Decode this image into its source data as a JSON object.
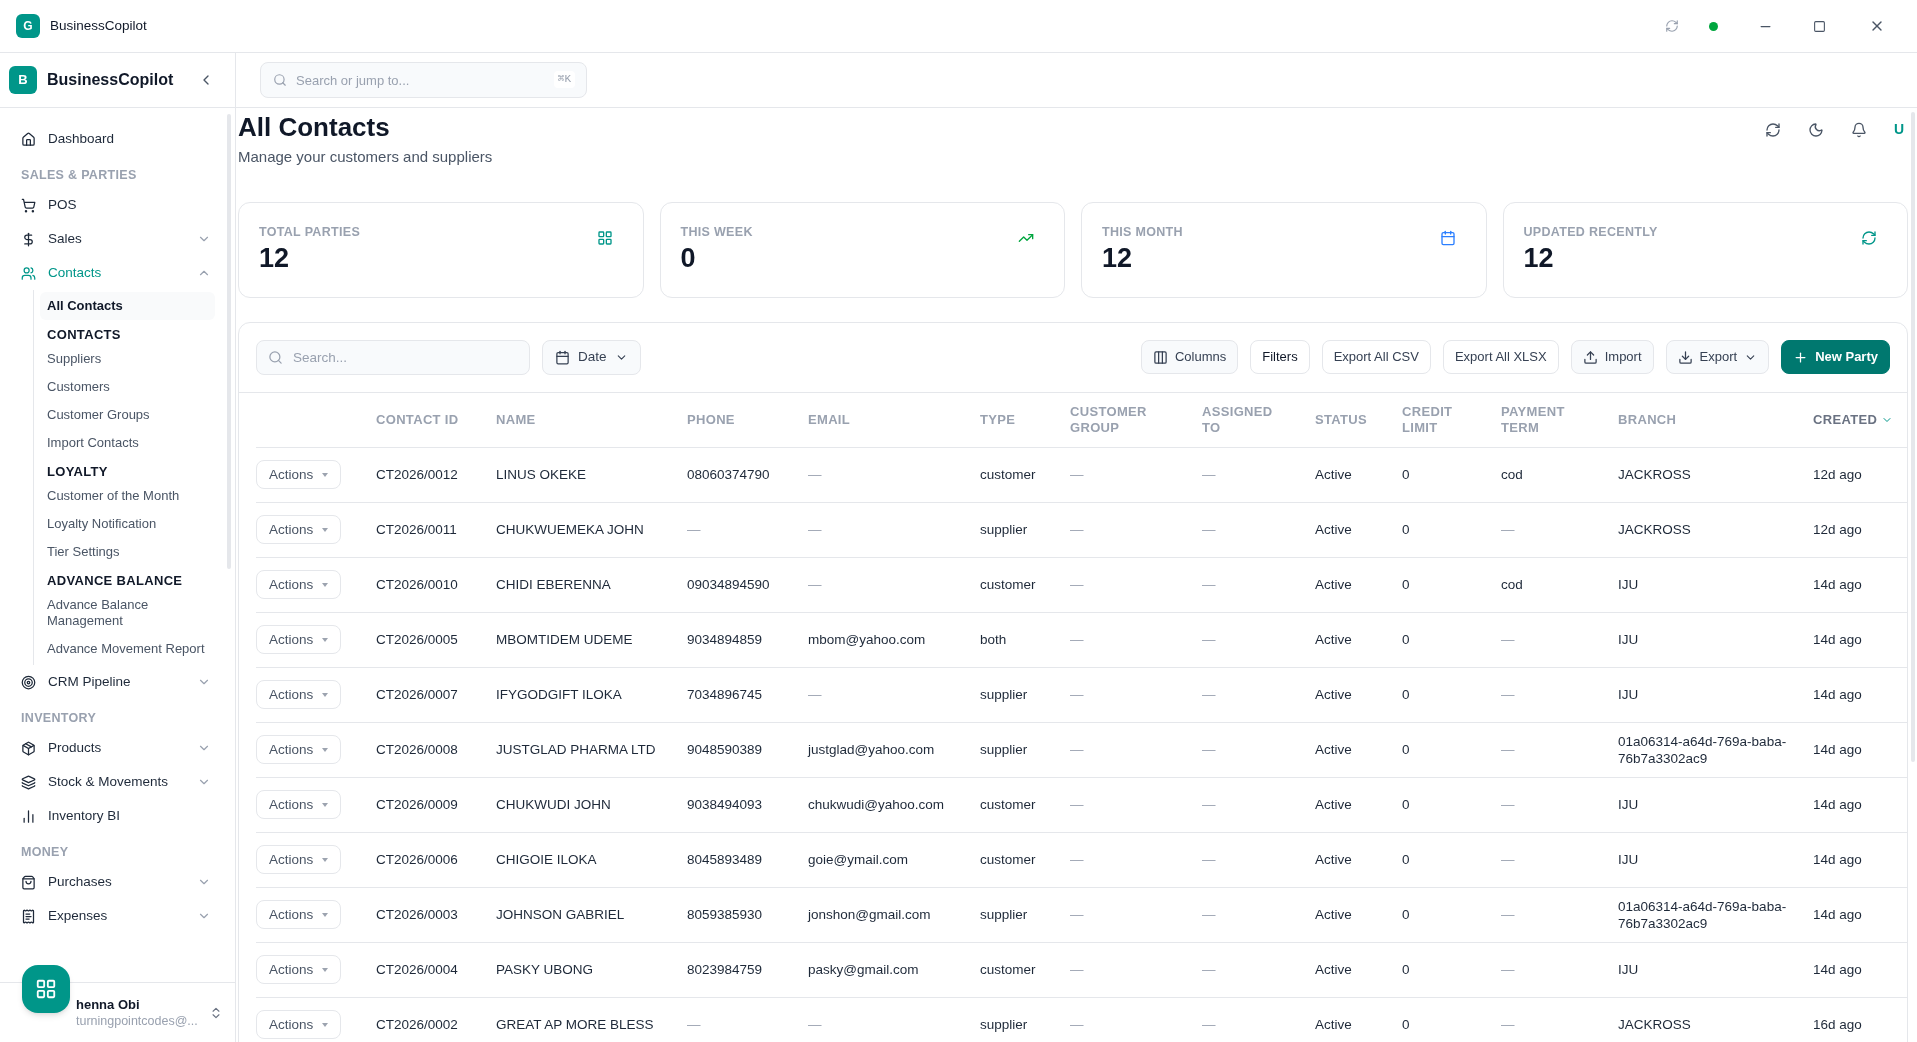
{
  "window": {
    "app_letter": "G",
    "title": "BusinessCopilot"
  },
  "sidebar": {
    "brand_letter": "B",
    "brand": "BusinessCopilot",
    "items": [
      {
        "kind": "item",
        "label": "Dashboard",
        "selected": false
      },
      {
        "kind": "section",
        "label": "SALES & PARTIES"
      },
      {
        "kind": "item",
        "label": "POS",
        "selected": false
      },
      {
        "kind": "item",
        "label": "Sales",
        "selected": false,
        "expanded": false
      },
      {
        "kind": "item",
        "label": "Contacts",
        "selected": true,
        "expanded": true,
        "children": [
          {
            "kind": "link",
            "label": "All Contacts",
            "selected": true
          },
          {
            "kind": "heading",
            "label": "CONTACTS"
          },
          {
            "kind": "link",
            "label": "Suppliers",
            "selected": false
          },
          {
            "kind": "link",
            "label": "Customers",
            "selected": false
          },
          {
            "kind": "link",
            "label": "Customer Groups",
            "selected": false
          },
          {
            "kind": "link",
            "label": "Import Contacts",
            "selected": false
          },
          {
            "kind": "heading",
            "label": "LOYALTY"
          },
          {
            "kind": "link",
            "label": "Customer of the Month",
            "selected": false
          },
          {
            "kind": "link",
            "label": "Loyalty Notification",
            "selected": false
          },
          {
            "kind": "link",
            "label": "Tier Settings",
            "selected": false
          },
          {
            "kind": "heading",
            "label": "ADVANCE BALANCE"
          },
          {
            "kind": "link",
            "label": "Advance Balance Management",
            "selected": false
          },
          {
            "kind": "link",
            "label": "Advance Movement Report",
            "selected": false
          }
        ]
      },
      {
        "kind": "item",
        "label": "CRM Pipeline",
        "selected": false,
        "expanded": false
      },
      {
        "kind": "section",
        "label": "INVENTORY"
      },
      {
        "kind": "item",
        "label": "Products",
        "selected": false,
        "expanded": false
      },
      {
        "kind": "item",
        "label": "Stock & Movements",
        "selected": false,
        "expanded": false
      },
      {
        "kind": "item",
        "label": "Inventory BI",
        "selected": false
      },
      {
        "kind": "section",
        "label": "MONEY"
      },
      {
        "kind": "item",
        "label": "Purchases",
        "selected": false,
        "expanded": false
      },
      {
        "kind": "item",
        "label": "Expenses",
        "selected": false,
        "expanded": false
      }
    ],
    "user": {
      "name": "henna Obi",
      "email": "turningpointcodes@..."
    }
  },
  "search": {
    "placeholder": "Search or jump to...",
    "shortcut": "⌘K"
  },
  "header": {
    "title": "All Contacts",
    "subtitle": "Manage your customers and suppliers",
    "avatar": "U"
  },
  "stats": [
    {
      "label": "TOTAL PARTIES",
      "value": "12"
    },
    {
      "label": "THIS WEEK",
      "value": "0"
    },
    {
      "label": "THIS MONTH",
      "value": "12"
    },
    {
      "label": "UPDATED RECENTLY",
      "value": "12"
    }
  ],
  "toolbar": {
    "search_placeholder": "Search...",
    "date": "Date",
    "buttons": [
      {
        "kind": "muted",
        "label": "Columns"
      },
      {
        "kind": "strong",
        "label": "Filters"
      },
      {
        "kind": "outline",
        "label": "Export All CSV"
      },
      {
        "kind": "outline",
        "label": "Export All XLSX"
      },
      {
        "kind": "muted",
        "label": "Import"
      },
      {
        "kind": "menu",
        "label": "Export"
      },
      {
        "kind": "primary",
        "label": "New Party"
      }
    ]
  },
  "table": {
    "columns": [
      {
        "label": "CONTACT ID",
        "sorted": false
      },
      {
        "label": "NAME",
        "sorted": false
      },
      {
        "label": "PHONE",
        "sorted": false
      },
      {
        "label": "EMAIL",
        "sorted": false
      },
      {
        "label": "TYPE",
        "sorted": false
      },
      {
        "label": "CUSTOMER GROUP",
        "sorted": false
      },
      {
        "label": "ASSIGNED TO",
        "sorted": false
      },
      {
        "label": "STATUS",
        "sorted": false
      },
      {
        "label": "CREDIT LIMIT",
        "sorted": false
      },
      {
        "label": "PAYMENT TERM",
        "sorted": false
      },
      {
        "label": "BRANCH",
        "sorted": false
      },
      {
        "label": "CREATED",
        "sorted": true
      }
    ],
    "rows": [
      {
        "action": "Actions",
        "cells": [
          "CT2026/0012",
          "LINUS OKEKE",
          "08060374790",
          "—",
          "customer",
          "—",
          "—",
          "Active",
          "0",
          "cod",
          "JACKROSS",
          "12d ago"
        ]
      },
      {
        "action": "Actions",
        "cells": [
          "CT2026/0011",
          "CHUKWUEMEKA JOHN",
          "—",
          "—",
          "supplier",
          "—",
          "—",
          "Active",
          "0",
          "—",
          "JACKROSS",
          "12d ago"
        ]
      },
      {
        "action": "Actions",
        "cells": [
          "CT2026/0010",
          "CHIDI EBERENNA",
          "09034894590",
          "—",
          "customer",
          "—",
          "—",
          "Active",
          "0",
          "cod",
          "IJU",
          "14d ago"
        ]
      },
      {
        "action": "Actions",
        "cells": [
          "CT2026/0005",
          "MBOMTIDEM UDEME",
          "9034894859",
          "mbom@yahoo.com",
          "both",
          "—",
          "—",
          "Active",
          "0",
          "—",
          "IJU",
          "14d ago"
        ]
      },
      {
        "action": "Actions",
        "cells": [
          "CT2026/0007",
          "IFYGODGIFT ILOKA",
          "7034896745",
          "—",
          "supplier",
          "—",
          "—",
          "Active",
          "0",
          "—",
          "IJU",
          "14d ago"
        ]
      },
      {
        "action": "Actions",
        "cells": [
          "CT2026/0008",
          "JUSTGLAD PHARMA LTD",
          "9048590389",
          "justglad@yahoo.com",
          "supplier",
          "—",
          "—",
          "Active",
          "0",
          "—",
          "01a06314-a64d-769a-baba-76b7a3302ac9",
          "14d ago"
        ]
      },
      {
        "action": "Actions",
        "cells": [
          "CT2026/0009",
          "CHUKWUDI JOHN",
          "9038494093",
          "chukwudi@yahoo.com",
          "customer",
          "—",
          "—",
          "Active",
          "0",
          "—",
          "IJU",
          "14d ago"
        ]
      },
      {
        "action": "Actions",
        "cells": [
          "CT2026/0006",
          "CHIGOIE ILOKA",
          "8045893489",
          "goie@ymail.com",
          "customer",
          "—",
          "—",
          "Active",
          "0",
          "—",
          "IJU",
          "14d ago"
        ]
      },
      {
        "action": "Actions",
        "cells": [
          "CT2026/0003",
          "JOHNSON GABRIEL",
          "8059385930",
          "jonshon@gmail.com",
          "supplier",
          "—",
          "—",
          "Active",
          "0",
          "—",
          "01a06314-a64d-769a-baba-76b7a3302ac9",
          "14d ago"
        ]
      },
      {
        "action": "Actions",
        "cells": [
          "CT2026/0004",
          "PASKY UBONG",
          "8023984759",
          "pasky@gmail.com",
          "customer",
          "—",
          "—",
          "Active",
          "0",
          "—",
          "IJU",
          "14d ago"
        ]
      },
      {
        "action": "Actions",
        "cells": [
          "CT2026/0002",
          "GREAT AP MORE BLESS",
          "—",
          "—",
          "supplier",
          "—",
          "—",
          "Active",
          "0",
          "—",
          "JACKROSS",
          "16d ago"
        ]
      }
    ]
  }
}
